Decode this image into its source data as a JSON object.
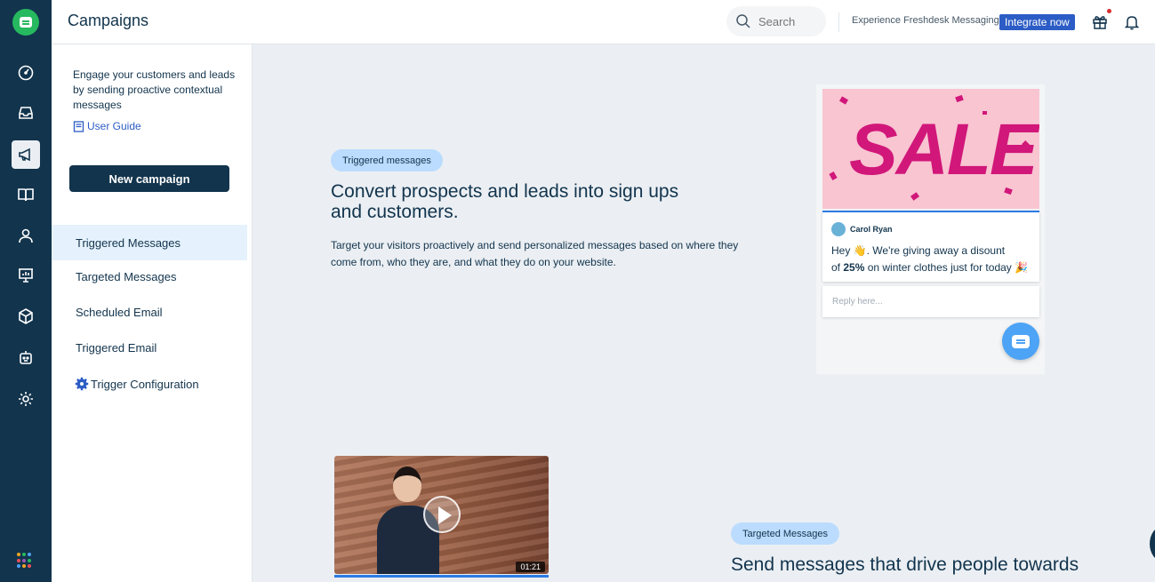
{
  "header": {
    "title": "Campaigns",
    "search_placeholder": "Search",
    "experience_text": "Experience Freshdesk Messaging",
    "integrate_label": "Integrate now"
  },
  "rail": {
    "items": [
      "dashboard-icon",
      "inbox-icon",
      "campaigns-icon",
      "knowledge-base-icon",
      "contacts-icon",
      "reports-icon",
      "apps-box-icon",
      "bot-icon",
      "settings-icon"
    ],
    "active": "campaigns-icon"
  },
  "sidebar": {
    "intro": "Engage your customers and leads by sending proactive contextual messages",
    "user_guide": "User Guide",
    "new_campaign": "New campaign",
    "items": [
      {
        "label": "Triggered Messages",
        "active": true
      },
      {
        "label": "Targeted Messages"
      },
      {
        "label": "Scheduled Email"
      },
      {
        "label": "Triggered Email"
      },
      {
        "label": "Trigger Configuration",
        "icon": "gear-icon"
      }
    ]
  },
  "main": {
    "section1": {
      "pill": "Triggered messages",
      "heading": "Convert prospects and leads into sign ups and customers.",
      "description": "Target your visitors proactively and send personalized messages based on where they come from, who they are, and what they do on your website."
    },
    "preview": {
      "banner_text": "SALE",
      "agent_name": "Carol Ryan",
      "message_1": "Hey 👋. We're giving away a disount",
      "message_2_prefix": "of ",
      "message_2_bold": "25%",
      "message_2_suffix": " on winter clothes just for today 🎉",
      "reply_placeholder": "Reply here..."
    },
    "section2": {
      "pill": "Targeted Messages",
      "heading": "Send messages that drive people towards",
      "video_duration": "01:21"
    }
  },
  "colors": {
    "rail_bg": "#12344d",
    "accent_blue": "#2c5cc5",
    "pill_bg": "#bbdcfe",
    "logo_green": "#26b95f",
    "sale_pink": "#d1177a"
  }
}
